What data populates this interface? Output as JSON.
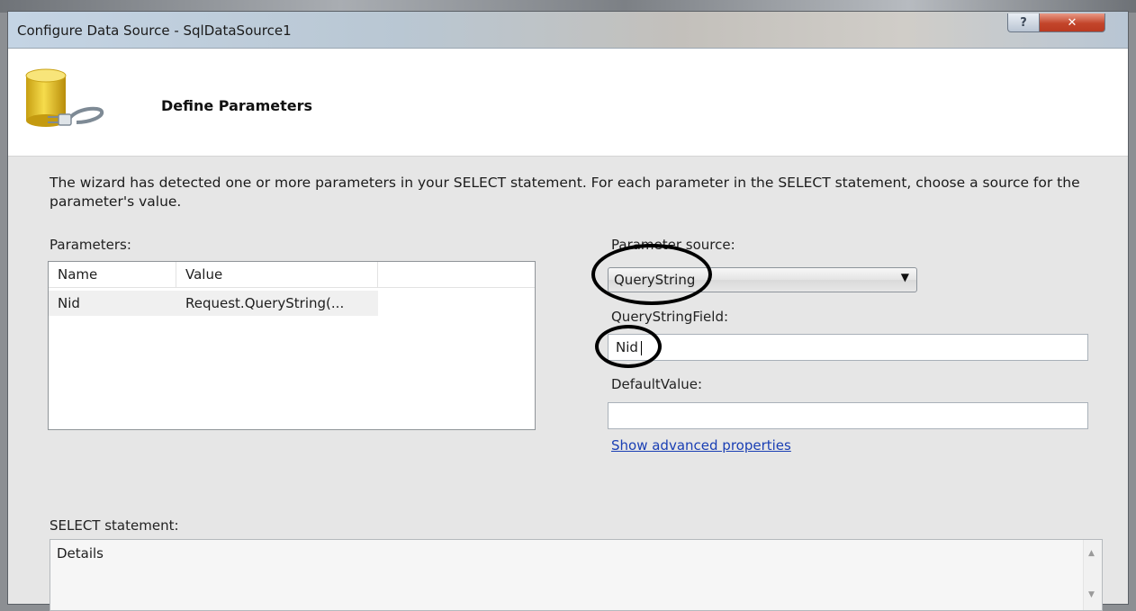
{
  "window": {
    "title": "Configure Data Source - SqlDataSource1",
    "help_label": "?",
    "close_label": "✕"
  },
  "header": {
    "title": "Define Parameters"
  },
  "description": "The wizard has detected one or more parameters in your SELECT statement. For each parameter in the SELECT statement, choose a source for the parameter's value.",
  "parameters": {
    "label": "Parameters:",
    "columns": [
      "Name",
      "Value"
    ],
    "rows": [
      {
        "name": "Nid",
        "value": "Request.QueryString(..."
      }
    ]
  },
  "parameter_source": {
    "label": "Parameter source:",
    "selected": "QueryString",
    "dropdown_icon": "chevron-down-icon"
  },
  "querystring_field": {
    "label": "QueryStringField:",
    "value": "Nid"
  },
  "default_value": {
    "label": "DefaultValue:",
    "value": ""
  },
  "advanced_link": "Show advanced properties",
  "select_statement": {
    "label": "SELECT statement:",
    "value": "Details"
  },
  "icons": [
    "database-plug-icon",
    "scroll-up-icon",
    "scroll-down-icon"
  ],
  "colors": {
    "dialog_bg": "#e6e6e6",
    "banner_bg": "#ffffff",
    "link": "#1a3fb4",
    "close_button": "#c3452b",
    "marker": "#000000"
  }
}
